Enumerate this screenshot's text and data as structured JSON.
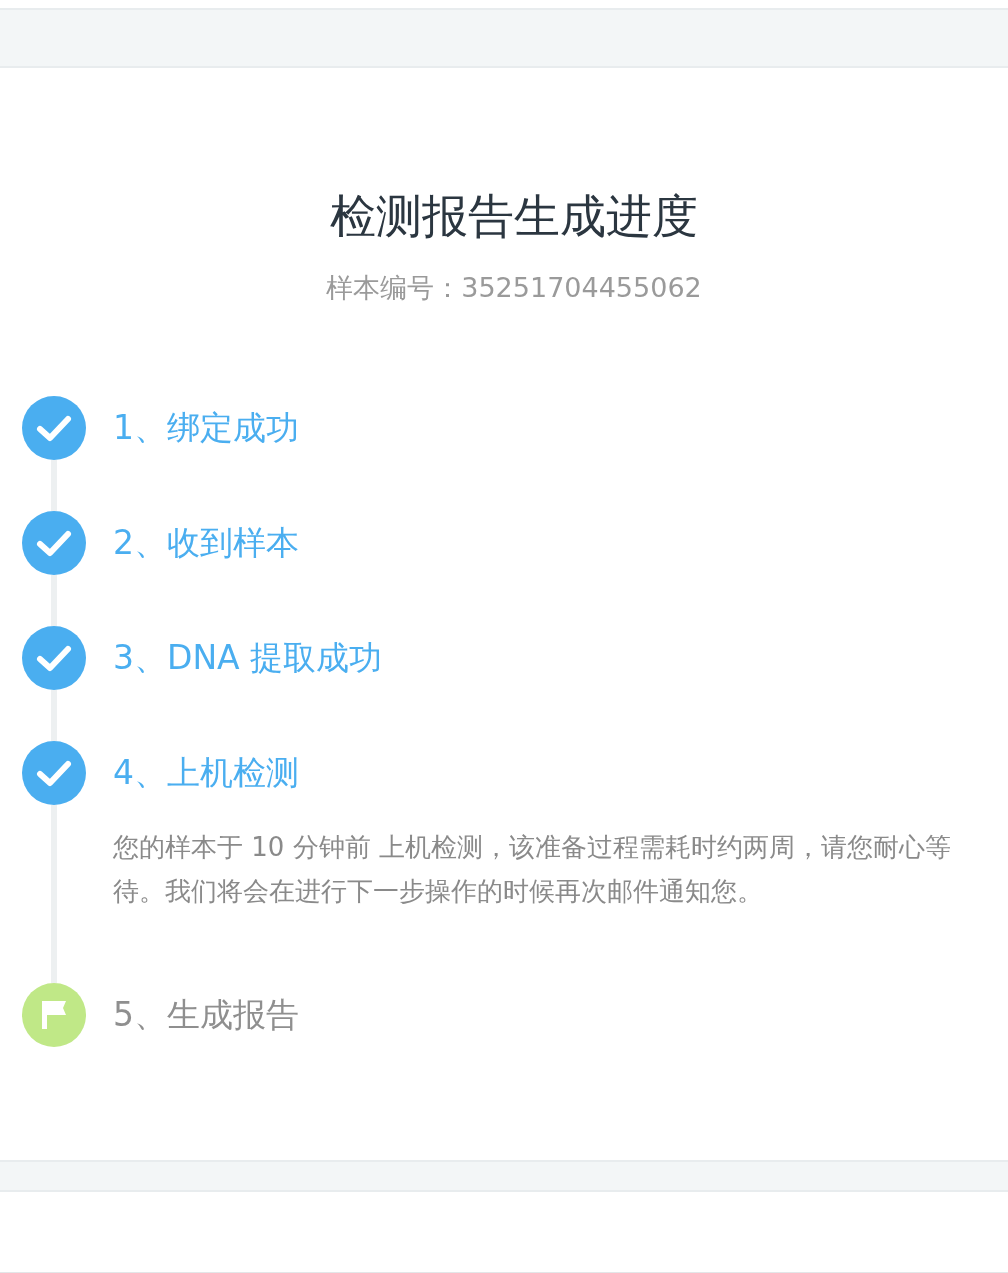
{
  "title": "检测报告生成进度",
  "sample": "样本编号：35251704455062",
  "steps": [
    {
      "label": "1、绑定成功",
      "done": true
    },
    {
      "label": "2、收到样本",
      "done": true
    },
    {
      "label": "3、DNA 提取成功",
      "done": true
    },
    {
      "label": "4、上机检测",
      "done": true,
      "description": "您的样本于 10 分钟前 上机检测，该准备过程需耗时约两周，请您耐心等待。我们将会在进行下一步操作的时候再次邮件通知您。"
    },
    {
      "label": "5、生成报告",
      "done": false
    }
  ]
}
